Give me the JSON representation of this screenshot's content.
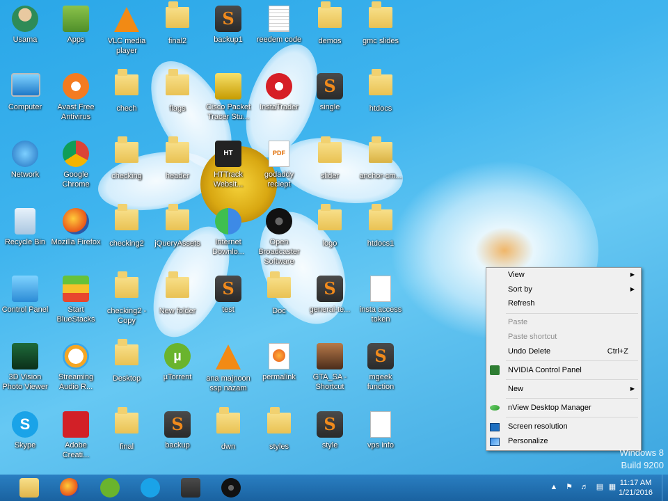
{
  "desktop": {
    "icons": [
      {
        "label": "Usama",
        "kind": "user-icon"
      },
      {
        "label": "Apps",
        "kind": "apps-icon"
      },
      {
        "label": "VLC media player",
        "kind": "vlc-icon"
      },
      {
        "label": "final2",
        "kind": "folder-icon"
      },
      {
        "label": "backup1",
        "kind": "sublime-icon"
      },
      {
        "label": "reedem code",
        "kind": "text-document-icon"
      },
      {
        "label": "demos",
        "kind": "folder-icon"
      },
      {
        "label": "gmc slides",
        "kind": "folder-icon"
      },
      {
        "label": "Computer",
        "kind": "computer-icon"
      },
      {
        "label": "Avast Free Antivirus",
        "kind": "avast-icon"
      },
      {
        "label": "chech",
        "kind": "folder-icon"
      },
      {
        "label": "flags",
        "kind": "folder-icon"
      },
      {
        "label": "Cisco Packet Tracer Stu...",
        "kind": "cisco-icon"
      },
      {
        "label": "InstaTrader",
        "kind": "instatrader-icon"
      },
      {
        "label": "single",
        "kind": "sublime-icon"
      },
      {
        "label": "htdocs",
        "kind": "folder-icon"
      },
      {
        "label": "Network",
        "kind": "network-icon"
      },
      {
        "label": "Google Chrome",
        "kind": "chrome-icon"
      },
      {
        "label": "checking",
        "kind": "folder-icon"
      },
      {
        "label": "header",
        "kind": "folder-icon"
      },
      {
        "label": "HTTrack Websit...",
        "kind": "httrack-icon"
      },
      {
        "label": "godaddy reciept",
        "kind": "pdf-icon"
      },
      {
        "label": "slider",
        "kind": "folder-icon"
      },
      {
        "label": "anchor-cm...",
        "kind": "zip-folder-icon"
      },
      {
        "label": "Recycle Bin",
        "kind": "recycle-bin-icon"
      },
      {
        "label": "Mozilla Firefox",
        "kind": "firefox-icon"
      },
      {
        "label": "checking2",
        "kind": "folder-icon"
      },
      {
        "label": "jQueryAssets",
        "kind": "folder-icon"
      },
      {
        "label": "Internet Downlo...",
        "kind": "idm-icon"
      },
      {
        "label": "Open Broadcaster Software",
        "kind": "obs-icon"
      },
      {
        "label": "logo",
        "kind": "folder-icon"
      },
      {
        "label": "htdocs1",
        "kind": "folder-icon"
      },
      {
        "label": "Control Panel",
        "kind": "control-panel-icon"
      },
      {
        "label": "Start BlueStacks",
        "kind": "bluestacks-icon"
      },
      {
        "label": "checking2 - Copy",
        "kind": "folder-icon"
      },
      {
        "label": "New folder",
        "kind": "folder-icon"
      },
      {
        "label": "test",
        "kind": "sublime-icon"
      },
      {
        "label": "Doc",
        "kind": "folder-icon"
      },
      {
        "label": "general-te...",
        "kind": "sublime-icon"
      },
      {
        "label": "insta access token",
        "kind": "blank-document-icon"
      },
      {
        "label": "3D Vision Photo Viewer",
        "kind": "3d-vision-icon"
      },
      {
        "label": "Streaming Audio R...",
        "kind": "streaming-audio-icon"
      },
      {
        "label": "Desktop",
        "kind": "folder-icon"
      },
      {
        "label": "µTorrent",
        "kind": "utorrent-icon"
      },
      {
        "label": "ana majnoon ssp nazam",
        "kind": "vlc-icon"
      },
      {
        "label": "permalink",
        "kind": "firefox-document-icon"
      },
      {
        "label": "GTA_SA - Shortcut",
        "kind": "gta-icon"
      },
      {
        "label": "mgeek function",
        "kind": "sublime-icon"
      },
      {
        "label": "Skype",
        "kind": "skype-icon"
      },
      {
        "label": "Adobe Creati...",
        "kind": "adobe-cc-icon"
      },
      {
        "label": "final",
        "kind": "folder-icon"
      },
      {
        "label": "backup",
        "kind": "sublime-icon"
      },
      {
        "label": "dwn",
        "kind": "folder-icon"
      },
      {
        "label": "styles",
        "kind": "folder-icon"
      },
      {
        "label": "style",
        "kind": "sublime-icon"
      },
      {
        "label": "vps info",
        "kind": "blank-document-icon"
      }
    ]
  },
  "context_menu": {
    "view": "View",
    "sort_by": "Sort by",
    "refresh": "Refresh",
    "paste": "Paste",
    "paste_shortcut": "Paste shortcut",
    "undo_delete": "Undo Delete",
    "undo_shortcut": "Ctrl+Z",
    "nvidia": "NVIDIA Control Panel",
    "new": "New",
    "nview": "nView Desktop Manager",
    "screen_resolution": "Screen resolution",
    "personalize": "Personalize"
  },
  "watermark": {
    "line1": "Windows 8",
    "line2": "Build 9200"
  },
  "taskbar": {
    "pinned": [
      "file-explorer-icon",
      "firefox-icon",
      "utorrent-icon",
      "skype-icon",
      "sublime-icon",
      "obs-icon"
    ],
    "clock_time": "11:17 AM",
    "clock_date": "1/21/2016"
  }
}
